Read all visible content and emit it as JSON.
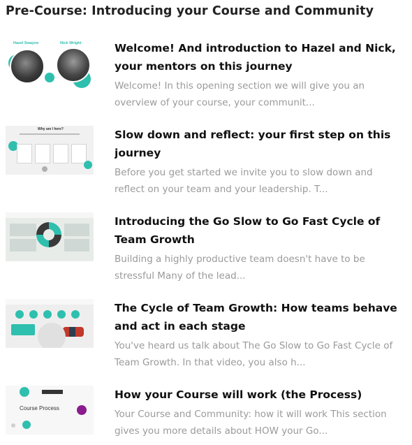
{
  "section": {
    "title": "Pre-Course: Introducing your Course and Community"
  },
  "lessons": [
    {
      "title": "Welcome! And introduction to Hazel and Nick, your mentors on this journey",
      "description": "Welcome!  In this opening section we will give you an overview of your course, your communit...",
      "thumb": {
        "label_left": "Hazel Swayne",
        "label_right": "Nick Wright"
      }
    },
    {
      "title": "Slow down and reflect: your first step on this journey",
      "description": "Before you get started we invite you to slow down and reflect on your team and your leadership. T...",
      "thumb": {
        "heading": "Why am I here?"
      }
    },
    {
      "title": "Introducing the Go Slow to Go Fast Cycle of Team Growth",
      "description": " Building a highly productive team doesn't have to be stressful  Many of the lead..."
    },
    {
      "title": "The Cycle of Team Growth: How teams behave and act in each stage",
      "description": "You've heard us talk about The Go Slow to Go Fast Cycle of Team Growth. In that video, you also h..."
    },
    {
      "title": "How your Course will work (the Process)",
      "description": "Your Course and Community: how it will work This section gives you more details about HOW your Go...",
      "thumb": {
        "label": "Course Process"
      }
    }
  ],
  "colors": {
    "accent": "#2fbfae",
    "purple": "#8a1c8f",
    "title_text": "#111111",
    "desc_text": "#9a9a9a"
  }
}
